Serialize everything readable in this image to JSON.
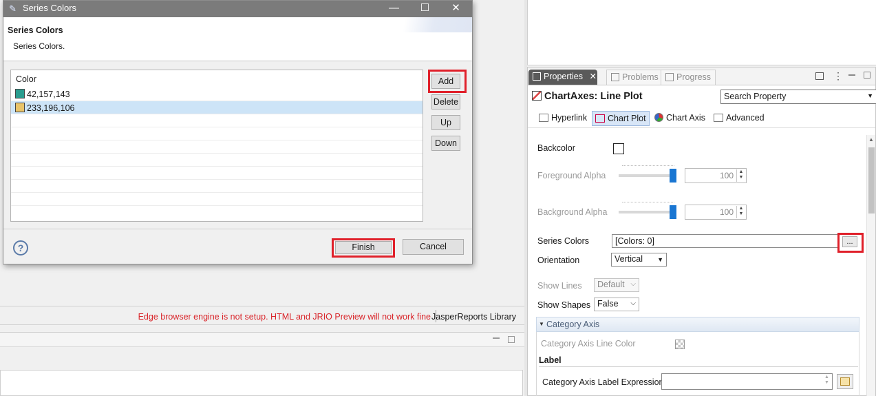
{
  "dialog": {
    "title": "Series Colors",
    "header_title": "Series Colors",
    "header_desc": "Series Colors.",
    "table": {
      "column_header": "Color",
      "rows": [
        {
          "color": "#2a9d8f",
          "label": "42,157,143"
        },
        {
          "color": "#e9c46a",
          "label": "233,196,106"
        }
      ]
    },
    "buttons": {
      "add": "Add",
      "delete": "Delete",
      "up": "Up",
      "down": "Down"
    },
    "footer": {
      "help": "?",
      "finish": "Finish",
      "cancel": "Cancel"
    },
    "window_controls": {
      "minimize": "—",
      "maximize": "☐",
      "close": "✕"
    }
  },
  "status_bar": {
    "message": "Edge browser engine is not setup. HTML and JRIO Preview will not work fine",
    "library": "JasperReports Library"
  },
  "properties": {
    "tabs": [
      {
        "label": "Properties",
        "close": "✕"
      },
      {
        "label": "Problems"
      },
      {
        "label": "Progress"
      }
    ],
    "view_menu": "⋮",
    "title": "ChartAxes: Line Plot",
    "search_placeholder": "Search Property",
    "subtabs": [
      "Hyperlink",
      "Chart Plot",
      "Chart Axis",
      "Advanced"
    ],
    "fields": {
      "backcolor_label": "Backcolor",
      "foreground_alpha_label": "Foreground Alpha",
      "foreground_alpha_value": "100",
      "background_alpha_label": "Background Alpha",
      "background_alpha_value": "100",
      "series_colors_label": "Series Colors",
      "series_colors_value": "[Colors: 0]",
      "series_colors_button": "...",
      "orientation_label": "Orientation",
      "orientation_value": "Vertical",
      "show_lines_label": "Show Lines",
      "show_lines_value": "Default",
      "show_shapes_label": "Show Shapes",
      "show_shapes_value": "False"
    },
    "category_axis": {
      "section_label": "Category Axis",
      "line_color_label": "Category Axis Line Color",
      "label_heading": "Label",
      "label_expression_label": "Category Axis Label Expression"
    }
  },
  "colors": {
    "highlight": "#e0202a",
    "status_error": "#d9262b",
    "selection": "#cde4f7",
    "slider_thumb": "#1976d2"
  }
}
